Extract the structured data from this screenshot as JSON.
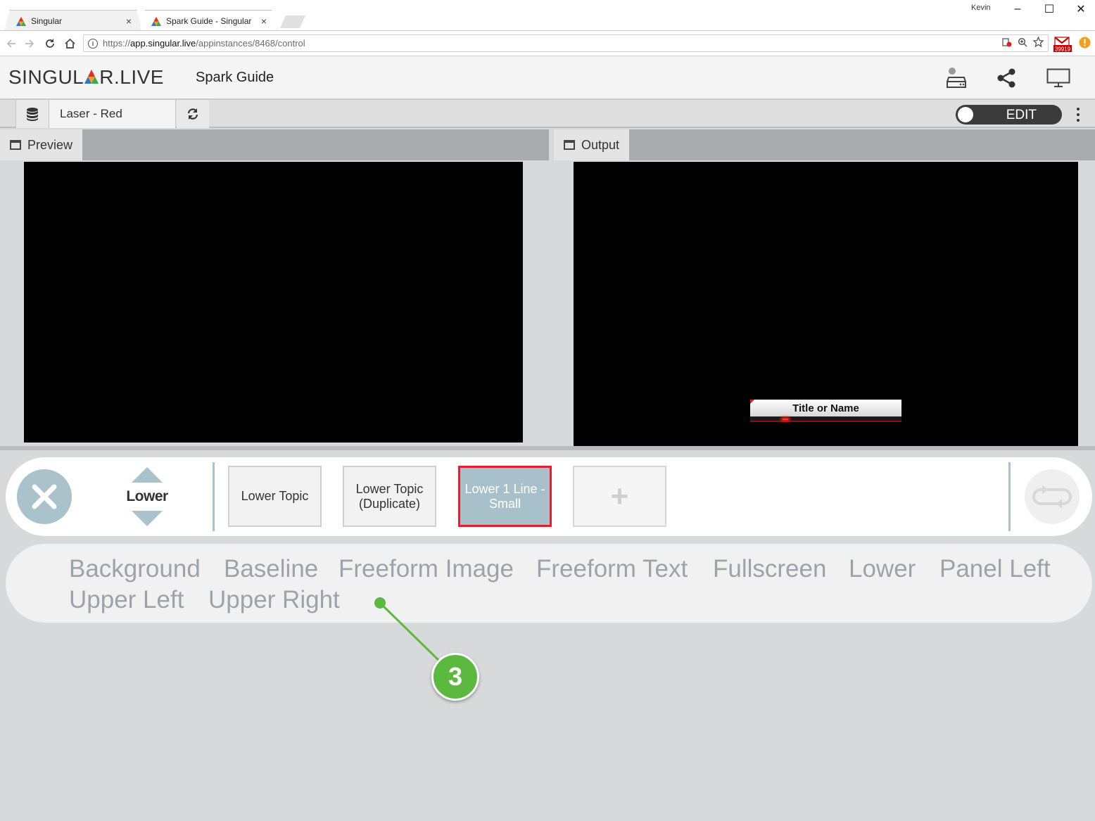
{
  "browser": {
    "tabs": [
      {
        "title": "Singular",
        "close": "×"
      },
      {
        "title": "Spark Guide - Singular",
        "close": "×"
      }
    ],
    "profile_name": "Kevin",
    "window_controls": {
      "minimize": "–",
      "maximize": "☐",
      "close": "✕"
    },
    "url": {
      "scheme": "https://",
      "host": "app.singular.live",
      "path": "/appinstances/8468/control"
    },
    "ext_badge": "39919"
  },
  "app": {
    "logo": {
      "part1": "SINGUL",
      "part2": "R.LIVE"
    },
    "title": "Spark Guide"
  },
  "toolbar": {
    "composition_name": "Laser - Red",
    "edit_label": "EDIT"
  },
  "panels": {
    "preview_label": "Preview",
    "output_label": "Output",
    "output_graphic_text": "Title or Name"
  },
  "controls": {
    "category_label": "Lower",
    "cards": [
      {
        "label": "Lower Topic",
        "active": false
      },
      {
        "label": "Lower Topic (Duplicate)",
        "active": false
      },
      {
        "label": "Lower 1 Line - Small",
        "active": true
      }
    ],
    "add_label": "+"
  },
  "categories": [
    "Background",
    "Baseline",
    "Freeform Image",
    "Freeform Text",
    "Fullscreen",
    "Lower",
    "Panel Left",
    "Upper Left",
    "Upper Right"
  ],
  "callout": {
    "number": "3",
    "color": "#5cb940"
  },
  "colors": {
    "accent": "#a9c2cc",
    "active_border": "#e0202c",
    "category_text": "#9ea3aa"
  }
}
